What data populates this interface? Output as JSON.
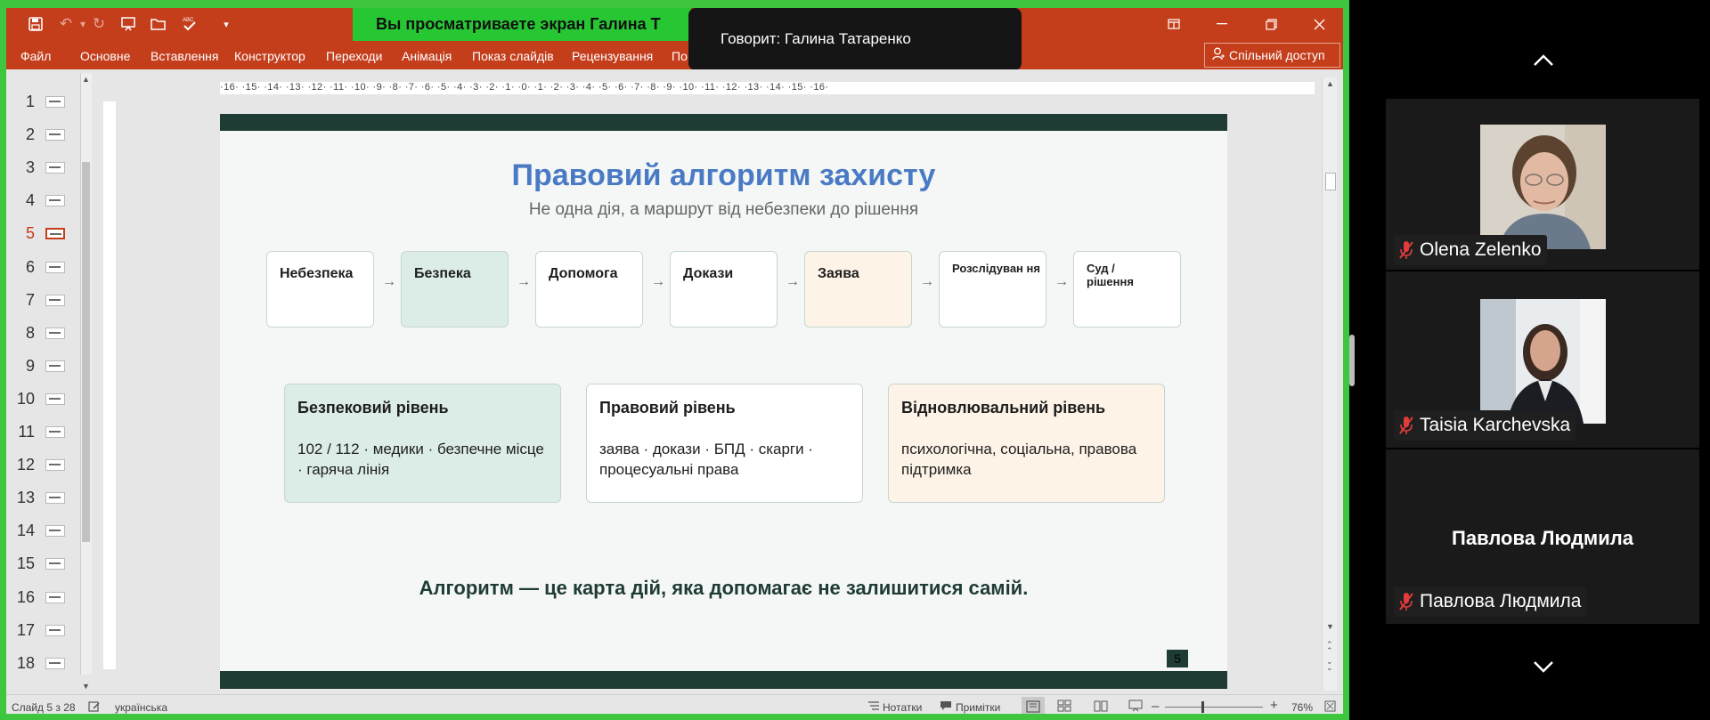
{
  "powerpoint": {
    "banner": "Вы просматриваете экран  Галина Т",
    "speaker_banner": "Говорит: Галина Татаренко",
    "tabs": [
      "Файл",
      "Основне",
      "Вставлення",
      "Конструктор",
      "Переходи",
      "Анімація",
      "Показ слайдів",
      "Рецензування",
      "По"
    ],
    "share_button": "Спільний доступ",
    "quick_access_icons": [
      "save-icon",
      "undo-icon",
      "redo-icon",
      "present-icon",
      "open-icon",
      "spelling-icon",
      "customize-icon"
    ],
    "window_controls": [
      "restore-ribbon-icon",
      "minimize-icon",
      "maximize-icon",
      "close-icon"
    ],
    "thumbnails": [
      "1",
      "2",
      "3",
      "4",
      "5",
      "6",
      "7",
      "8",
      "9",
      "10",
      "11",
      "12",
      "13",
      "14",
      "15",
      "16",
      "17",
      "18"
    ],
    "selected_slide": "5",
    "ruler_text": "·16· ·15· ·14· ·13· ·12· ·11· ·10· ·9· ·8· ·7· ·6· ·5· ·4· ·3· ·2· ·1· ·0· ·1· ·2· ·3· ·4· ·5· ·6· ·7· ·8· ·9· ·10· ·11· ·12· ·13· ·14· ·15· ·16·"
  },
  "slide": {
    "title": "Правовий алгоритм захисту",
    "subtitle": "Не одна дія, а маршрут від небезпеки до рішення",
    "steps": [
      "Небезпека",
      "Безпека",
      "Допомога",
      "Докази",
      "Заява",
      "Розслідуван ня",
      "Суд / рішення"
    ],
    "levels": [
      {
        "title": "Безпековий рівень",
        "body": "102 / 112 · медики · безпечне місце · гаряча лінія"
      },
      {
        "title": "Правовий рівень",
        "body": "заява · докази · БПД · скарги · процесуальні права"
      },
      {
        "title": "Відновлювальний рівень",
        "body": "психологічна, соціальна, правова підтримка"
      }
    ],
    "footer": "Алгоритм — це карта дій, яка допомагає не залишитися самій.",
    "page_number": "5",
    "colors": {
      "title": "#4a7ac4",
      "band": "#1f3b35",
      "green": "#dcede8",
      "peach": "#fdf3e6"
    }
  },
  "status": {
    "slide_info": "Слайд 5 з 28",
    "language": "українська",
    "notes": "Нотатки",
    "comments": "Примітки",
    "zoom": "76%"
  },
  "participants": [
    {
      "name": "Olena Zelenko",
      "muted": true,
      "has_video": true
    },
    {
      "name": "Taisia Karchevska",
      "muted": true,
      "has_video": true
    },
    {
      "name": "Павлова Людмила",
      "muted": true,
      "has_video": false
    }
  ]
}
